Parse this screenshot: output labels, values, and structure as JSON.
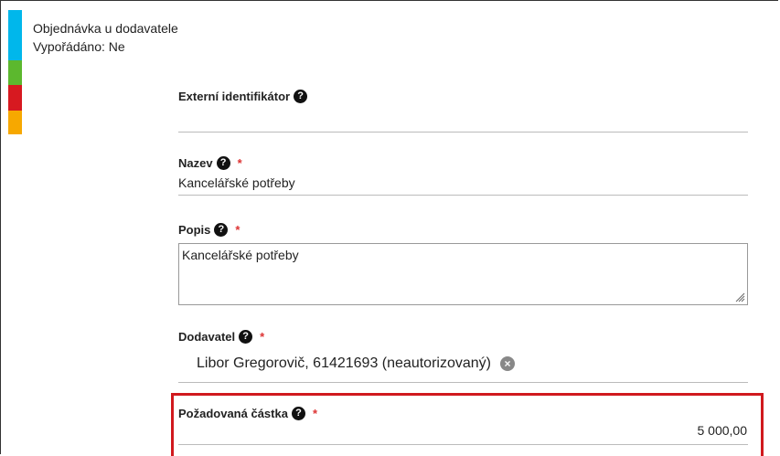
{
  "header": {
    "title": "Objednávka u dodavatele",
    "status": "Vypořádáno: Ne"
  },
  "status_colors": [
    "#00b7eb",
    "#00b7eb",
    "#5cb82e",
    "#d71920",
    "#f7a800"
  ],
  "fields": {
    "external_id": {
      "label": "Externí identifikátor",
      "value": ""
    },
    "name": {
      "label": "Nazev",
      "required_mark": "*",
      "value": "Kancelářské potřeby"
    },
    "description": {
      "label": "Popis",
      "required_mark": "*",
      "value": "Kancelářské potřeby"
    },
    "supplier": {
      "label": "Dodavatel",
      "required_mark": "*",
      "value": "Libor Gregorovič, 61421693 (neautorizovaný)"
    },
    "amount": {
      "label": "Požadovaná částka",
      "required_mark": "*",
      "value": "5 000,00"
    }
  },
  "icons": {
    "help": "?",
    "clear": "×"
  }
}
